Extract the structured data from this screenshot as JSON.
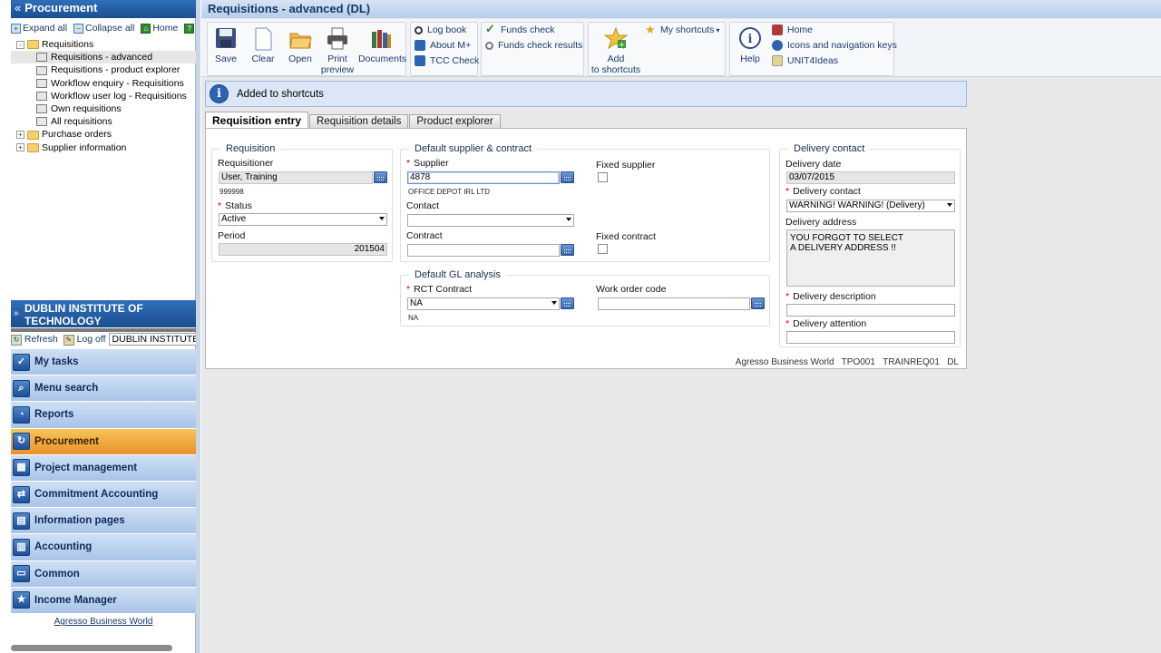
{
  "left": {
    "header": "Procurement",
    "toolbar": {
      "expand_all": "Expand all",
      "collapse_all": "Collapse all",
      "home": "Home"
    },
    "tree": [
      {
        "label": "Requisitions",
        "level": 0,
        "type": "folder",
        "state": "-"
      },
      {
        "label": "Requisitions - advanced",
        "level": 1,
        "type": "doc",
        "selected": true
      },
      {
        "label": "Requisitions - product explorer",
        "level": 1,
        "type": "doc"
      },
      {
        "label": "Workflow enquiry - Requisitions",
        "level": 1,
        "type": "doc"
      },
      {
        "label": "Workflow user log - Requisitions",
        "level": 1,
        "type": "doc"
      },
      {
        "label": "Own requisitions",
        "level": 1,
        "type": "doc"
      },
      {
        "label": "All requisitions",
        "level": 1,
        "type": "doc"
      },
      {
        "label": "Purchase orders",
        "level": 0,
        "type": "folder",
        "state": "+"
      },
      {
        "label": "Supplier information",
        "level": 0,
        "type": "folder",
        "state": "+"
      }
    ],
    "org": "DUBLIN INSTITUTE OF TECHNOLOGY",
    "org_toolbar": {
      "refresh": "Refresh",
      "logoff": "Log off",
      "client": "DUBLIN INSTITUTE OF"
    },
    "modules": [
      {
        "label": "My tasks",
        "icon": "check-icon"
      },
      {
        "label": "Menu search",
        "icon": "search-icon"
      },
      {
        "label": "Reports",
        "icon": "report-icon"
      },
      {
        "label": "Procurement",
        "icon": "procurement-icon",
        "active": true
      },
      {
        "label": "Project management",
        "icon": "project-icon"
      },
      {
        "label": "Commitment Accounting",
        "icon": "commitment-icon"
      },
      {
        "label": "Information pages",
        "icon": "info-pages-icon"
      },
      {
        "label": "Accounting",
        "icon": "accounting-icon"
      },
      {
        "label": "Common",
        "icon": "common-icon"
      },
      {
        "label": "Income Manager",
        "icon": "star-icon"
      }
    ],
    "footer_link": "Agresso Business World"
  },
  "main": {
    "title": "Requisitions - advanced (DL)",
    "ribbon": {
      "save": "Save",
      "clear": "Clear",
      "open": "Open",
      "print_line1": "Print",
      "print_line2": "preview",
      "documents": "Documents",
      "log_book": "Log book",
      "about": "About M+",
      "tcc": "TCC Check",
      "funds_check": "Funds check",
      "funds_check_results": "Funds check results",
      "add_line1": "Add",
      "add_line2": "to shortcuts",
      "my_shortcuts": "My shortcuts",
      "help": "Help",
      "home": "Home",
      "icons_keys": "Icons and navigation keys",
      "unit4ideas": "UNIT4Ideas"
    },
    "info_message": "Added to shortcuts",
    "tabs": [
      "Requisition entry",
      "Requisition details",
      "Product explorer"
    ],
    "requisition": {
      "legend": "Requisition",
      "requisitioner_label": "Requisitioner",
      "requisitioner_value": "User, Training",
      "requisitioner_id": "999998",
      "status_label": "Status",
      "status_value": "Active",
      "period_label": "Period",
      "period_value": "201504"
    },
    "supplier": {
      "legend": "Default supplier & contract",
      "supplier_label": "Supplier",
      "supplier_value": "4878",
      "supplier_name": "OFFICE DEPOT IRL LTD",
      "contact_label": "Contact",
      "contact_value": "",
      "contract_label": "Contract",
      "contract_value": "",
      "fixed_supplier_label": "Fixed supplier",
      "fixed_contract_label": "Fixed contract"
    },
    "gl": {
      "legend": "Default GL analysis",
      "rct_label": "RCT Contract",
      "rct_value": "NA",
      "rct_desc": "NA",
      "work_order_label": "Work order code",
      "work_order_value": ""
    },
    "delivery": {
      "legend": "Delivery contact",
      "date_label": "Delivery date",
      "date_value": "03/07/2015",
      "contact_label": "Delivery contact",
      "contact_value": "WARNING! WARNING! (Delivery)",
      "address_label": "Delivery address",
      "address_value": "YOU FORGOT TO SELECT\nA DELIVERY ADDRESS !!",
      "description_label": "Delivery description",
      "description_value": "",
      "attention_label": "Delivery attention",
      "attention_value": ""
    },
    "footer": "Agresso Business World   TPO001   TRAINREQ01   DL"
  }
}
